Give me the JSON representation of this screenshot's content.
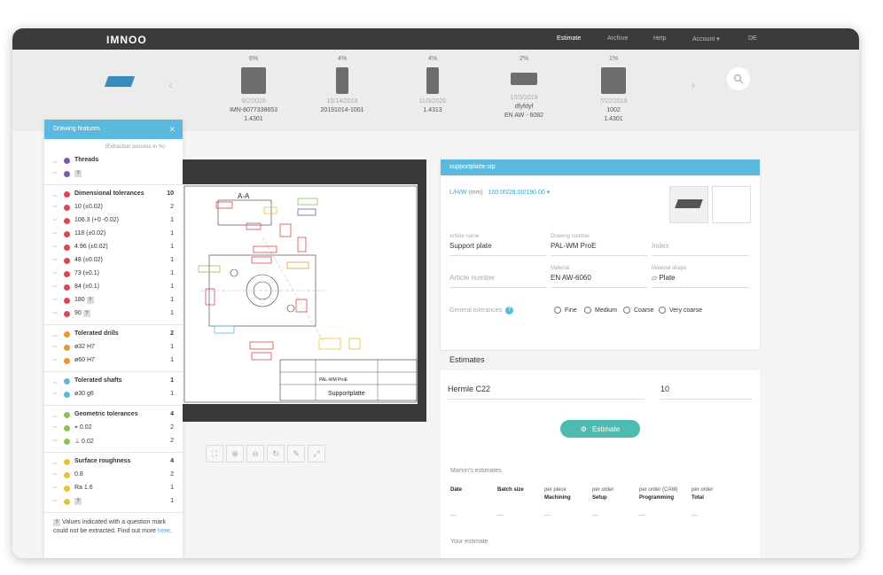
{
  "app": {
    "logo": "IMNOO",
    "nav": [
      {
        "label": "Estimate",
        "active": true
      },
      {
        "label": "Archive",
        "active": false
      },
      {
        "label": "Help",
        "active": false
      },
      {
        "label": "Account ▾",
        "active": false
      },
      {
        "label": "DE",
        "active": false
      }
    ]
  },
  "strip": {
    "items": [
      {
        "pct": "6%",
        "date": "9/2/2020",
        "id": "IMN-8077338653",
        "material": "1.4301"
      },
      {
        "pct": "4%",
        "date": "10/14/2019",
        "id": "20191014-1001",
        "material": ""
      },
      {
        "pct": "4%",
        "date": "11/3/2020",
        "id": "1.4313",
        "material": ""
      },
      {
        "pct": "2%",
        "date": "10/3/2019",
        "id": "dfyfdyf",
        "material": "EN AW - 6082"
      },
      {
        "pct": "1%",
        "date": "7/22/2019",
        "id": "1002",
        "material": "1.4301"
      }
    ]
  },
  "features": {
    "title": "Drawing features",
    "subtitle": "(Extraction success in %)",
    "groups": [
      {
        "name": "Threads",
        "color": "#7a5aa8",
        "count": "",
        "items": [
          {
            "label": "?",
            "count": "",
            "q": true
          }
        ]
      },
      {
        "name": "Dimensional tolerances",
        "color": "#d94b4b",
        "count": "10",
        "items": [
          {
            "label": "10 (±0.02)",
            "count": "2"
          },
          {
            "label": "106.3 (+0 -0.02)",
            "count": "1"
          },
          {
            "label": "118 (±0.02)",
            "count": "1"
          },
          {
            "label": "4.96 (±0.02)",
            "count": "1"
          },
          {
            "label": "48 (±0.02)",
            "count": "1"
          },
          {
            "label": "73 (±0.1)",
            "count": "1"
          },
          {
            "label": "84 (±0.1)",
            "count": "1"
          },
          {
            "label": "180",
            "count": "1",
            "q": true
          },
          {
            "label": "90",
            "count": "1",
            "q": true
          }
        ]
      },
      {
        "name": "Tolerated drills",
        "color": "#e59a3a",
        "count": "2",
        "items": [
          {
            "label": "ø32 H7",
            "count": "1"
          },
          {
            "label": "ø60 H7",
            "count": "1"
          }
        ]
      },
      {
        "name": "Tolerated shafts",
        "color": "#5bb9dd",
        "count": "1",
        "items": [
          {
            "label": "ø30 g6",
            "count": "1"
          }
        ]
      },
      {
        "name": "Geometric tolerances",
        "color": "#8cc15a",
        "count": "4",
        "items": [
          {
            "label": "⌖ 0.02",
            "count": "2"
          },
          {
            "label": "⊥ 0.02",
            "count": "2"
          }
        ]
      },
      {
        "name": "Surface roughness",
        "color": "#e8c23a",
        "count": "4",
        "items": [
          {
            "label": "0.8",
            "count": "2"
          },
          {
            "label": "Ra 1.6",
            "count": "1"
          },
          {
            "label": "?",
            "count": "1",
            "q": true
          }
        ]
      }
    ],
    "note": "Values indicated with a question mark could not be extracted. Find out more",
    "note_link": "here."
  },
  "viewer": {
    "section_label": "A-A",
    "title_block": "Supportplatte",
    "drawing_no": "PAL-WM ProE",
    "tools": [
      "fit-icon",
      "zoom-in-icon",
      "zoom-out-icon",
      "rotate-icon",
      "marker-icon",
      "fullscreen-icon"
    ]
  },
  "article": {
    "file": "supportplatte.stp",
    "lhw_label": "L/H/W (mm)",
    "lhw_value": "100.00/28.00/190.00 ▾",
    "article_name_label": "Article name",
    "article_name": "Support plate",
    "drawing_number_label": "Drawing number",
    "drawing_number": "PAL-WM ProE",
    "index_placeholder": "Index",
    "article_number_placeholder": "Article number",
    "material_label": "Material",
    "material": "EN AW-6060",
    "shape_label": "Material shape",
    "shape": "Plate",
    "tolerances_label": "General tolerances",
    "tolerances": [
      "Fine",
      "Medium",
      "Coarse",
      "Very coarse"
    ]
  },
  "estimates": {
    "title": "Estimates",
    "machine": "Hermle C22",
    "quantity": "10",
    "button": "Estimate",
    "marvin_label": "Marvin's estimates",
    "columns": [
      {
        "top": "",
        "bottom": "Date"
      },
      {
        "top": "",
        "bottom": "Batch size"
      },
      {
        "top": "per piece",
        "bottom": "Machining"
      },
      {
        "top": "per order",
        "bottom": "Setup"
      },
      {
        "top": "per order (CAM)",
        "bottom": "Programming"
      },
      {
        "top": "per order",
        "bottom": "Total"
      }
    ],
    "dash": "—",
    "your_estimate": "Your estimate"
  }
}
